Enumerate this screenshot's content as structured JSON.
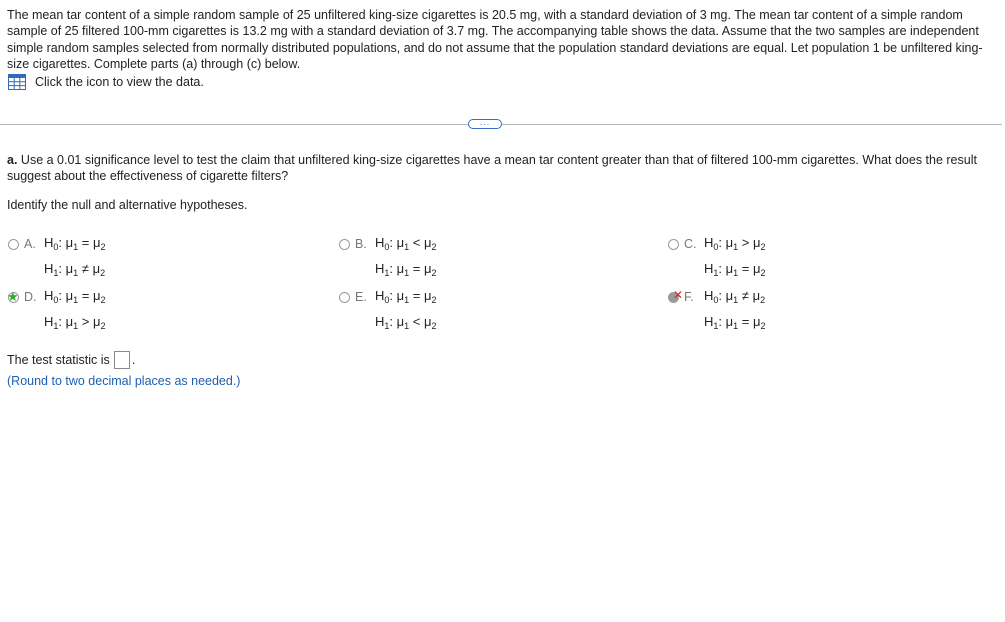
{
  "intro_text": "The mean tar content of a simple random sample of 25 unfiltered king-size cigarettes is 20.5 mg, with a standard deviation of 3 mg. The mean tar content of a simple random sample of 25 filtered 100-mm cigarettes is 13.2 mg with a standard deviation of 3.7 mg. The accompanying table shows the data. Assume that the two samples are independent simple random samples selected from normally distributed populations, and do not assume that the population standard deviations are equal. Let population 1 be unfiltered king-size cigarettes. Complete parts (a) through (c) below.",
  "view_data": {
    "label": "Click the icon to view the data.",
    "icon": "table-grid-icon",
    "icon_color": "#2f6db8"
  },
  "expand_button": {
    "label": "..."
  },
  "question": {
    "part_label": "a.",
    "text": " Use a 0.01 significance level to test the claim that unfiltered king-size cigarettes have a mean tar content greater than that of filtered 100-mm cigarettes. What does the result suggest about the effectiveness of cigarette filters?"
  },
  "instruction": "Identify the null and alternative hypotheses.",
  "options": [
    {
      "letter": "A.",
      "h0_op": "=",
      "h1_op": "≠",
      "state": "none"
    },
    {
      "letter": "B.",
      "h0_op": "<",
      "h1_op": "=",
      "state": "none"
    },
    {
      "letter": "C.",
      "h0_op": ">",
      "h1_op": "=",
      "state": "none"
    },
    {
      "letter": "D.",
      "h0_op": "=",
      "h1_op": ">",
      "state": "correct"
    },
    {
      "letter": "E.",
      "h0_op": "=",
      "h1_op": "<",
      "state": "none"
    },
    {
      "letter": "F.",
      "h0_op": "≠",
      "h1_op": "=",
      "state": "incorrect-selected"
    }
  ],
  "hyp_labels": {
    "h0": "H",
    "h0_sub": "0",
    "h1": "H",
    "h1_sub": "1",
    "mu": "μ",
    "mu1_sub": "1",
    "mu2_sub": "2",
    "colon": ":"
  },
  "test_statistic": {
    "label": "The test statistic is",
    "value": "",
    "suffix": "."
  },
  "round_note": "(Round to two decimal places as needed.)",
  "colors": {
    "correct_star": "#2eaa2e",
    "incorrect_x": "#d9261c",
    "link_blue": "#1f5fb3"
  }
}
